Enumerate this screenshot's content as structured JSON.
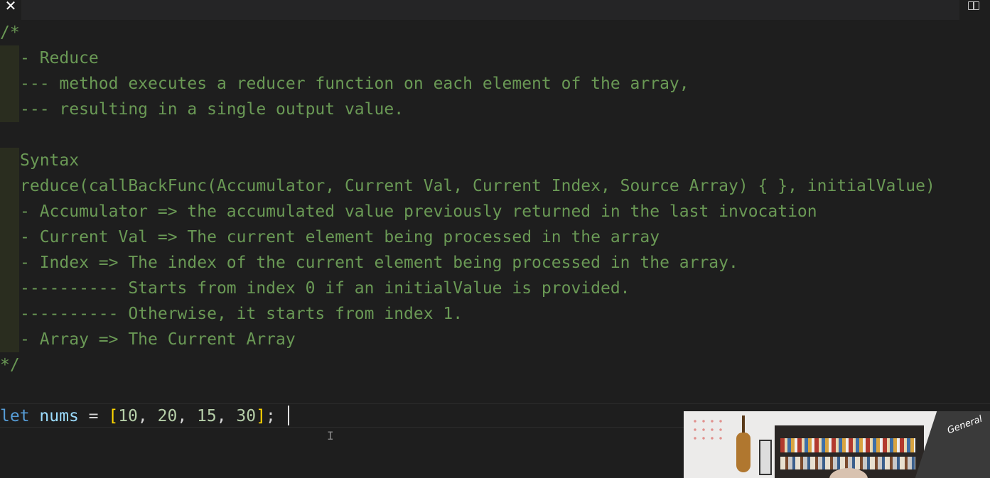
{
  "window": {
    "close_label": "✕",
    "split_icon": "split-editor-icon"
  },
  "code": {
    "comment_open": "/*",
    "l1": "- Reduce",
    "l2": "--- method executes a reducer function on each element of the array,",
    "l3": "--- resulting in a single output value.",
    "l4": "Syntax",
    "l5": "reduce(callBackFunc(Accumulator, Current Val, Current Index, Source Array) { }, initialValue)",
    "l6": "- Accumulator => the accumulated value previously returned in the last invocation",
    "l7": "- Current Val => The current element being processed in the array",
    "l8": "- Index => The index of the current element being processed in the array.",
    "l9": "---------- Starts from index 0 if an initialValue is provided.",
    "l10": "---------- Otherwise, it starts from index 1.",
    "l11": "- Array => The Current Array",
    "comment_close": "*/",
    "code_line": {
      "keyword": "let",
      "variable": "nums",
      "op": " = ",
      "open_bracket": "[",
      "v1": "10",
      "v2": "20",
      "v3": "15",
      "v4": "30",
      "sep": ", ",
      "close_bracket": "]",
      "semicolon": ";"
    }
  },
  "webcam": {
    "banner_text": "General"
  },
  "colors": {
    "background": "#1e1e1e",
    "comment": "#6a9955",
    "keyword": "#569cd6",
    "variable": "#9cdcfe",
    "number": "#b5cea8",
    "bracket": "#ffd700"
  }
}
